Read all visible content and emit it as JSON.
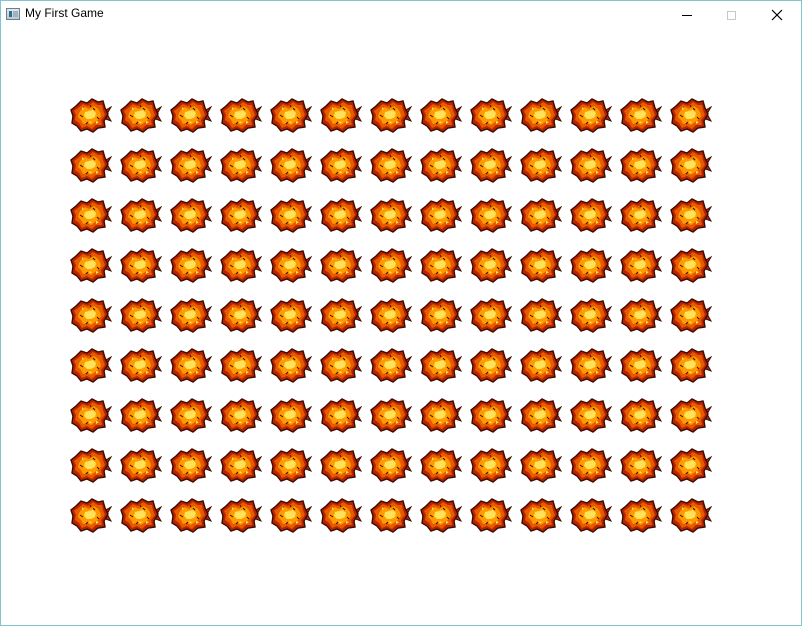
{
  "window": {
    "title": "My First Game",
    "icon": "app-window-icon",
    "buttons": [
      {
        "name": "minimize",
        "icon": "minimize-icon"
      },
      {
        "name": "maximize",
        "icon": "maximize-icon",
        "enabled": false
      },
      {
        "name": "close",
        "icon": "close-icon"
      }
    ]
  },
  "scene": {
    "background": "#ffffff",
    "sprite": "explosion-sprite",
    "grid": {
      "rows": 9,
      "columns": 13
    },
    "colors": {
      "outline": "#3a0a00",
      "outer": "#b82400",
      "mid": "#e65a00",
      "inner": "#ff9a00",
      "core": "#ffe15a"
    }
  }
}
